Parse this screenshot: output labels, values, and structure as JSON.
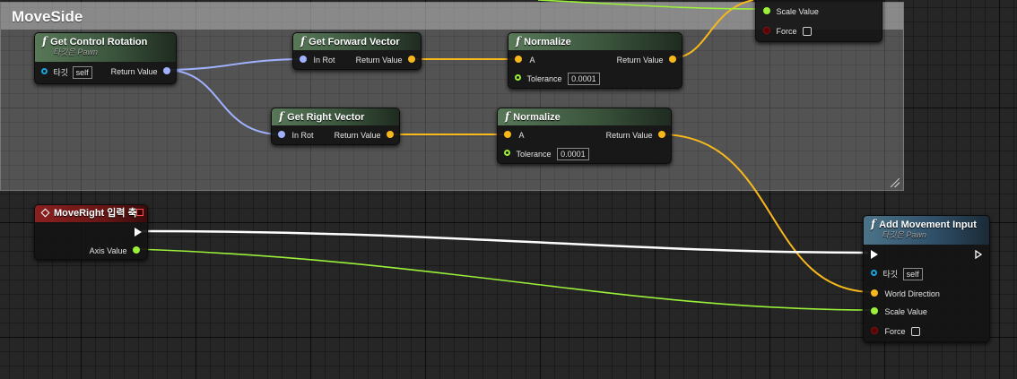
{
  "comment": {
    "title": "MoveSide"
  },
  "colors": {
    "vector_pin": "#f7b81c",
    "rotator_pin": "#a0b2ff",
    "float_pin": "#9bf03a",
    "object_pin": "#16a4de",
    "exec_wire": "#ffffff"
  },
  "nodes": {
    "get_control_rotation": {
      "title": "Get Control Rotation",
      "subtitle": "타깃은 Pawn",
      "target_label": "타깃",
      "target_value": "self",
      "return_label": "Return Value"
    },
    "get_forward_vector": {
      "title": "Get Forward Vector",
      "input_label": "In Rot",
      "return_label": "Return Value"
    },
    "get_right_vector": {
      "title": "Get Right Vector",
      "input_label": "In Rot",
      "return_label": "Return Value"
    },
    "normalize_top": {
      "title": "Normalize",
      "input_label": "A",
      "return_label": "Return Value",
      "tolerance_label": "Tolerance",
      "tolerance_value": "0.0001"
    },
    "normalize_bottom": {
      "title": "Normalize",
      "input_label": "A",
      "return_label": "Return Value",
      "tolerance_label": "Tolerance",
      "tolerance_value": "0.0001"
    },
    "add_movement_partial": {
      "scale_label": "Scale Value",
      "force_label": "Force"
    },
    "move_right_event": {
      "title": "MoveRight 입력 축",
      "axis_label": "Axis Value"
    },
    "add_movement_input": {
      "title": "Add Movement Input",
      "subtitle": "타깃은 Pawn",
      "target_label": "타깃",
      "target_value": "self",
      "direction_label": "World Direction",
      "scale_label": "Scale Value",
      "force_label": "Force"
    }
  }
}
